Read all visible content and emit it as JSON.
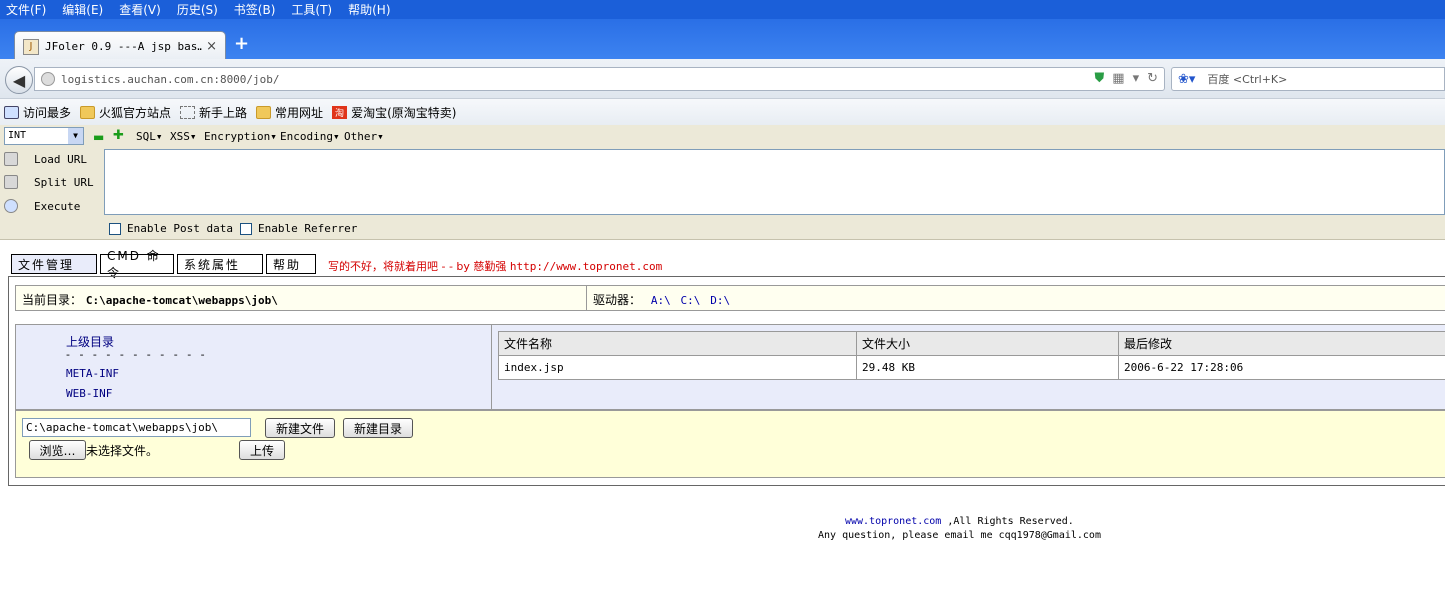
{
  "menubar": {
    "items": [
      "文件(F)",
      "编辑(E)",
      "查看(V)",
      "历史(S)",
      "书签(B)",
      "工具(T)",
      "帮助(H)"
    ]
  },
  "tab": {
    "title": "JFoler 0.9 ---A jsp bas…",
    "close": "×",
    "new_tab": "+"
  },
  "navbar": {
    "url": "logistics.auchan.com.cn:8000/job/",
    "search_placeholder": "百度 <Ctrl+K>"
  },
  "bookmarks": [
    "访问最多",
    "火狐官方站点",
    "新手上路",
    "常用网址",
    "爱淘宝(原淘宝特卖)"
  ],
  "hackbar": {
    "select_value": "INT",
    "menus": [
      "SQL▾",
      "XSS▾",
      "Encryption▾",
      "Encoding▾",
      "Other▾"
    ],
    "actions": [
      "Load URL",
      "Split URL",
      "Execute"
    ],
    "checkboxes": [
      "Enable Post data",
      "Enable Referrer"
    ]
  },
  "page": {
    "tabs": [
      "文件管理",
      "CMD 命令",
      "系统属性",
      "帮助"
    ],
    "slogan_cn": "写的不好，将就着用吧 - - by 慈勤强",
    "slogan_url": "http://www.topronet.com",
    "current_dir_label": "当前目录：",
    "current_dir": "C:\\apache-tomcat\\webapps\\job\\",
    "drives_label": "驱动器：",
    "drives": [
      "A:\\",
      "C:\\",
      "D:\\"
    ],
    "parent_dir": "上级目录",
    "separator": "- - - - - - - - - - -",
    "dirs": [
      "META-INF",
      "WEB-INF"
    ],
    "file_table": {
      "headers": [
        "文件名称",
        "文件大小",
        "最后修改"
      ],
      "rows": [
        [
          "index.jsp",
          "29.48 KB",
          "2006-6-22 17:28:06"
        ]
      ]
    },
    "path_input": "C:\\apache-tomcat\\webapps\\job\\",
    "new_file_btn": "新建文件",
    "new_dir_btn": "新建目录",
    "browse_btn": "浏览…",
    "no_file": "未选择文件。",
    "upload_btn": "上传"
  },
  "footer": {
    "site": "www.topronet.com",
    "rights": ",All Rights Reserved.",
    "contact": "Any question, please email me cqq1978@Gmail.com"
  }
}
